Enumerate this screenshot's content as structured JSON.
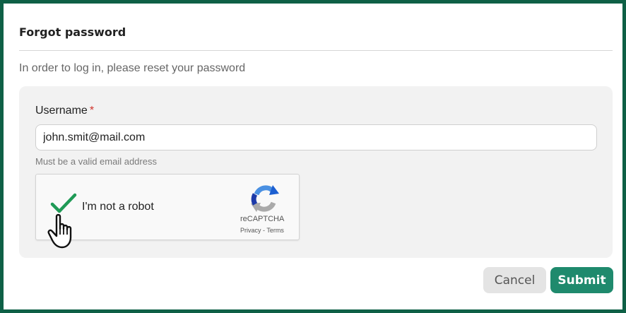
{
  "dialog": {
    "title": "Forgot password",
    "subtitle": "In order to log in, please reset your password"
  },
  "form": {
    "username_label": "Username",
    "required_marker": "*",
    "username_value": "john.smit@mail.com",
    "username_hint": "Must be a valid email address"
  },
  "captcha": {
    "checkbox_label": "I'm not a robot",
    "checked": true,
    "brand": "reCAPTCHA",
    "privacy_link": "Privacy",
    "separator": "-",
    "terms_link": "Terms",
    "icon": "recaptcha-logo-icon"
  },
  "actions": {
    "cancel_label": "Cancel",
    "submit_label": "Submit"
  },
  "colors": {
    "frame_border": "#0e6046",
    "primary": "#1f8a6d",
    "required": "#d0342c",
    "check": "#1f9a56"
  }
}
